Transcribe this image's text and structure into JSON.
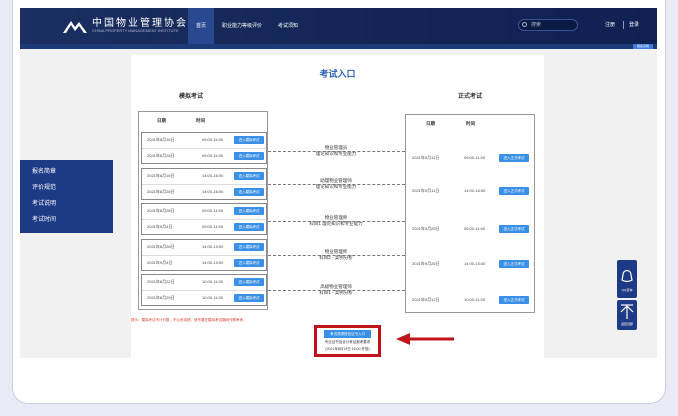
{
  "header": {
    "logo_title": "中国物业管理协会",
    "logo_subtitle": "CHINA PROPERTY MANAGEMENT INSTITUTE",
    "nav": [
      "首页",
      "职业能力等级评价",
      "考试须知"
    ],
    "search_placeholder": "搜索",
    "register": "注册",
    "login": "登录",
    "strip_tag": "报名系统"
  },
  "sidebar": {
    "items": [
      "报名简章",
      "评价规范",
      "考试说明",
      "考试时间"
    ]
  },
  "page": {
    "title": "考试入口",
    "mock_title": "模拟考试",
    "formal_title": "正式考试",
    "col_date": "日期",
    "col_time": "时间"
  },
  "mock_groups": [
    {
      "rows": [
        {
          "date": "2021年8月16日",
          "time": "09:00-11:00",
          "btn": "进入模拟考试"
        },
        {
          "date": "2021年8月28日",
          "time": "09:00-11:00",
          "btn": "进入模拟考试"
        }
      ]
    },
    {
      "rows": [
        {
          "date": "2021年8月16日",
          "time": "14:00-16:00",
          "btn": "进入模拟考试"
        },
        {
          "date": "2021年8月28日",
          "time": "14:00-16:00",
          "btn": "进入模拟考试"
        }
      ]
    },
    {
      "rows": [
        {
          "date": "2021年8月28日",
          "time": "09:00-11:00",
          "btn": "进入模拟考试"
        },
        {
          "date": "2021年9月4日",
          "time": "09:00-11:00",
          "btn": "进入模拟考试"
        }
      ]
    },
    {
      "rows": [
        {
          "date": "2021年8月28日",
          "time": "14:00-15:00",
          "btn": "进入模拟考试"
        },
        {
          "date": "2021年9月4日",
          "time": "14:00-15:00",
          "btn": "进入模拟考试"
        }
      ]
    },
    {
      "rows": [
        {
          "date": "2021年8月22日",
          "time": "10:00-11:00",
          "btn": "进入模拟考试"
        },
        {
          "date": "2021年8月29日",
          "time": "10:00-11:00",
          "btn": "进入模拟考试"
        }
      ]
    }
  ],
  "subjects": [
    {
      "line1": "物业管理员",
      "line2": "理论知识和专业能力"
    },
    {
      "line1": "助理物业管理师",
      "line2": "理论知识和专业能力"
    },
    {
      "line1": "物业管理师",
      "line2": "科目1 理论知识和专业能力"
    },
    {
      "line1": "物业管理师",
      "line2": "科目2 - 案例分析"
    },
    {
      "line1": "高级物业管理师",
      "line2": "科目1 - 案例分析"
    }
  ],
  "formal_rows": [
    {
      "date": "2021年9月11日",
      "time": "09:00-11:00",
      "btn": "进入正式考试"
    },
    {
      "date": "2021年9月11日",
      "time": "14:00-16:00",
      "btn": "进入正式考试"
    },
    {
      "date": "2021年9月25日",
      "time": "09:00-11:00",
      "btn": "进入正式考试"
    },
    {
      "date": "2021年9月25日",
      "time": "14:00-15:00",
      "btn": "进入正式考试"
    },
    {
      "date": "2021年9月12日",
      "time": "10:00-11:00",
      "btn": "进入正式考试"
    }
  ],
  "footer": {
    "note": "提示：模拟考试不计分数，不公布成绩，请不要在模拟考试期间作弊考考。",
    "cert_button": "考试成绩报告证书入口",
    "cert_line1": "专业证书及合计考证报考要求",
    "cert_line2": "(2021年8月19日 16:00 开放)"
  },
  "float": {
    "qq": "QQ咨询",
    "top": "返回顶部"
  },
  "colors": {
    "header": "#132656",
    "accent": "#3a8fe6",
    "title": "#2b5fb4",
    "highlight": "#c0141a",
    "sidebar": "#1d3a86"
  }
}
